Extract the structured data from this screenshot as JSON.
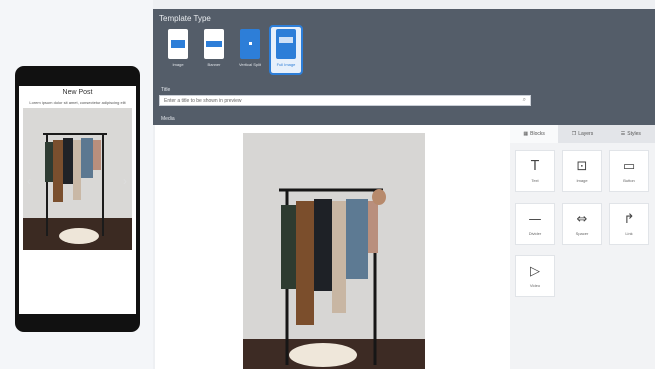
{
  "preview": {
    "title": "New Post",
    "subtitle": "Lorem ipsum dolor sit amet, consectetur adipiscing elit",
    "prev_arrow": "‹",
    "next_arrow": "›"
  },
  "editor": {
    "section_title": "Template Type",
    "types": [
      {
        "label": "Image",
        "selected": false
      },
      {
        "label": "Banner",
        "selected": false
      },
      {
        "label": "Vertical Split",
        "selected": false
      },
      {
        "label": "Full Image",
        "selected": true
      }
    ],
    "title_label": "Title",
    "title_placeholder": "Enter a title to be shown in preview",
    "media_label": "Media"
  },
  "panel": {
    "tabs": [
      {
        "label": "Blocks",
        "icon": "grid-icon",
        "active": true
      },
      {
        "label": "Layers",
        "icon": "layers-icon",
        "active": false
      },
      {
        "label": "Styles",
        "icon": "style-icon",
        "active": false
      }
    ],
    "tools": [
      {
        "label": "Text",
        "glyph": "T"
      },
      {
        "label": "Image",
        "glyph": "⊡"
      },
      {
        "label": "Button",
        "glyph": "▭"
      },
      {
        "label": "Divider",
        "glyph": "—"
      },
      {
        "label": "Spacer",
        "glyph": "⇔"
      },
      {
        "label": "Link",
        "glyph": "↱"
      },
      {
        "label": "Video",
        "glyph": "▷"
      }
    ]
  },
  "colors": {
    "header_bg": "#545d69",
    "accent": "#2d7ed8"
  }
}
